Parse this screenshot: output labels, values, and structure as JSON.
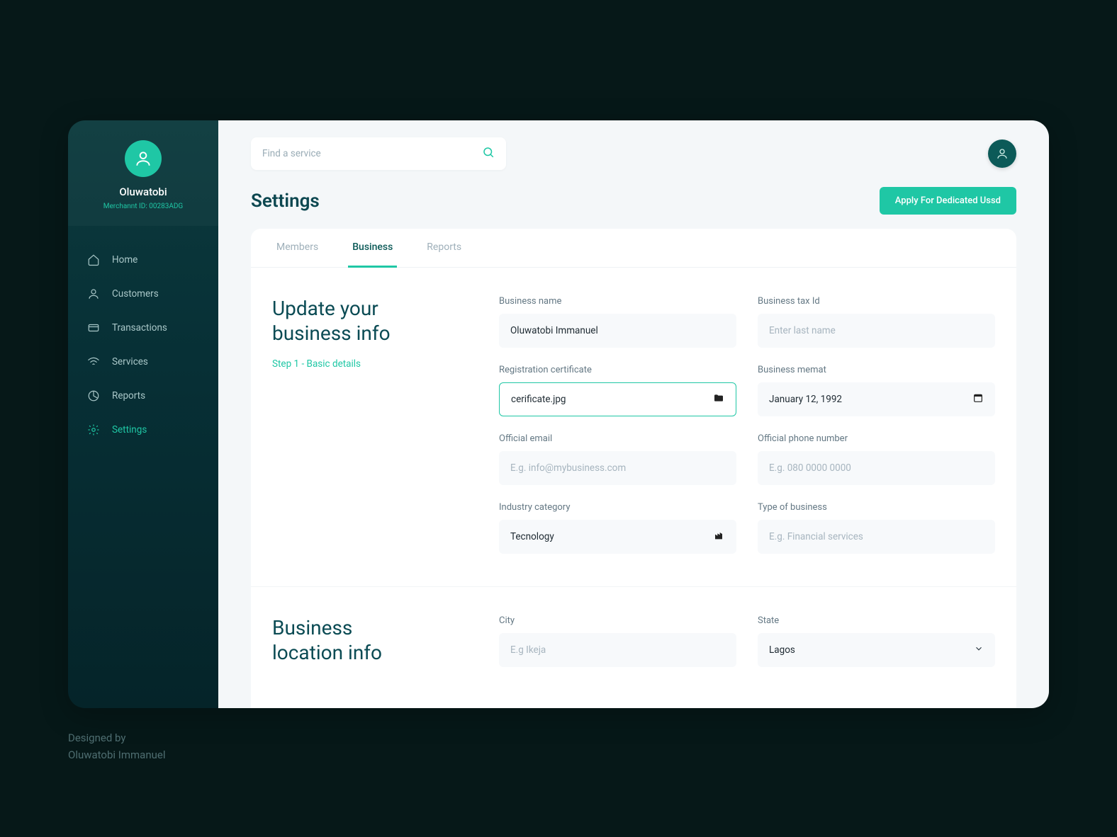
{
  "profile": {
    "name": "Oluwatobi",
    "merchant_id": "Merchannt ID: 00283ADG"
  },
  "sidebar": {
    "items": [
      {
        "label": "Home"
      },
      {
        "label": "Customers"
      },
      {
        "label": "Transactions"
      },
      {
        "label": "Services"
      },
      {
        "label": "Reports"
      },
      {
        "label": "Settings"
      }
    ]
  },
  "search": {
    "placeholder": "Find a service"
  },
  "page": {
    "title": "Settings",
    "cta": "Apply For Dedicated Ussd"
  },
  "tabs": [
    {
      "label": "Members"
    },
    {
      "label": "Business"
    },
    {
      "label": "Reports"
    }
  ],
  "section1": {
    "title_l1": "Update your",
    "title_l2": "business info",
    "step": "Step 1 - Basic details",
    "business_name": {
      "label": "Business name",
      "value": "Oluwatobi Immanuel"
    },
    "tax_id": {
      "label": "Business tax Id",
      "placeholder": "Enter last name"
    },
    "reg_cert": {
      "label": "Registration certificate",
      "value": "cerificate.jpg"
    },
    "memat": {
      "label": "Business memat",
      "value": "January 12, 1992"
    },
    "email": {
      "label": "Official email",
      "placeholder": "E.g. info@mybusiness.com"
    },
    "phone": {
      "label": "Official phone number",
      "placeholder": "E.g. 080 0000 0000"
    },
    "industry": {
      "label": "Industry category",
      "value": "Tecnology"
    },
    "biz_type": {
      "label": "Type of business",
      "placeholder": "E.g. Financial services"
    }
  },
  "section2": {
    "title_l1": "Business",
    "title_l2": "location info",
    "city": {
      "label": "City",
      "placeholder": "E.g Ikeja"
    },
    "state": {
      "label": "State",
      "value": "Lagos"
    }
  },
  "credit": {
    "line1": "Designed by",
    "line2": "Oluwatobi Immanuel"
  }
}
